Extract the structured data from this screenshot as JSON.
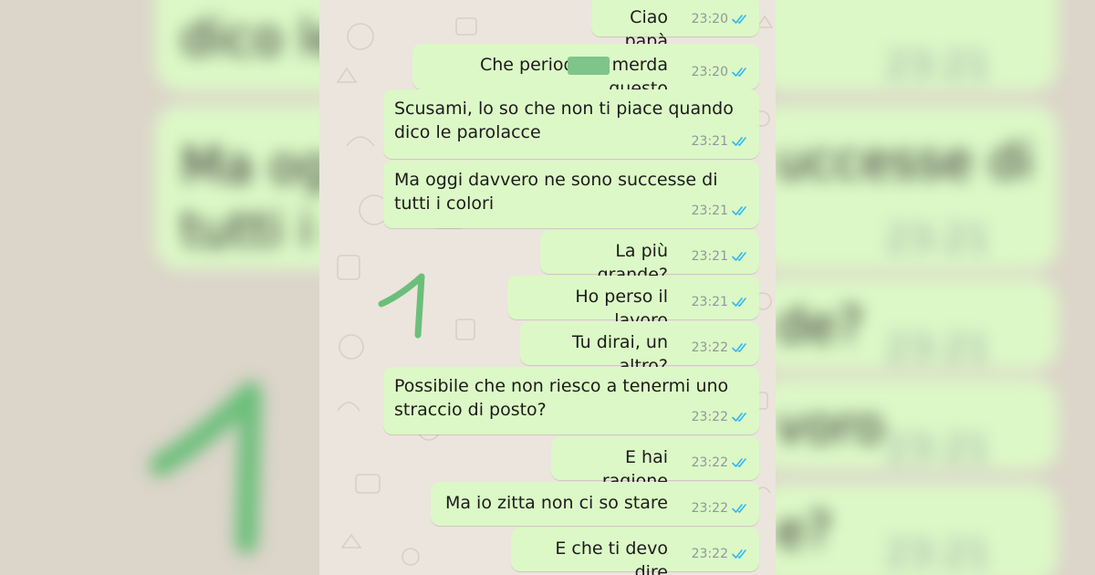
{
  "colors": {
    "bubble_outgoing": "#dcf8c6",
    "wallpaper": "#ece5dd",
    "read_ticks": "#34b7f1",
    "timestamp": "#8f979c",
    "annotation_green": "#6bbf7a"
  },
  "messages": [
    {
      "text": "Ciao papà",
      "time": "23:20"
    },
    {
      "text": "Che periodo di merda questo",
      "time": "23:20",
      "redacted": true
    },
    {
      "text": "Scusami, lo so che non ti piace quando\ndico le parolacce",
      "time": "23:21"
    },
    {
      "text": "Ma oggi davvero ne sono successe di\ntutti i colori",
      "time": "23:21"
    },
    {
      "text": "La più grande?",
      "time": "23:21"
    },
    {
      "text": "Ho perso il lavoro",
      "time": "23:21"
    },
    {
      "text": "Tu dirai, un altro?",
      "time": "23:22"
    },
    {
      "text": "Possibile che non riesco a tenermi uno\nstraccio di posto?",
      "time": "23:22"
    },
    {
      "text": "E hai ragione",
      "time": "23:22"
    },
    {
      "text": "Ma io zitta non ci so stare",
      "time": "23:22"
    },
    {
      "text": "E che ti devo dire",
      "time": "23:22"
    }
  ],
  "annotation_mark": "1",
  "background_blur": {
    "snippets": [
      "dico le",
      "Ma og",
      "tutti i c",
      "uccesse di",
      "de?",
      "voro",
      "e?"
    ],
    "times": [
      "23:21",
      "23:21",
      "23:21",
      "23:21",
      "23:21"
    ]
  }
}
